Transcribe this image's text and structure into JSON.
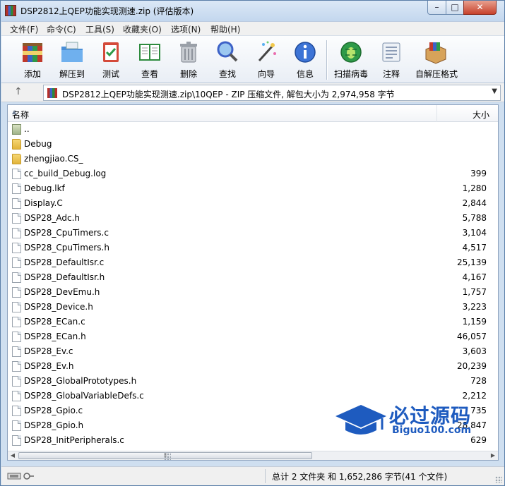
{
  "window": {
    "title": "DSP2812上QEP功能实现测速.zip (评估版本)",
    "controls": {
      "minimize": "–",
      "maximize": "□",
      "close": "✕"
    }
  },
  "menu": [
    "文件(F)",
    "命令(C)",
    "工具(S)",
    "收藏夹(O)",
    "选项(N)",
    "帮助(H)"
  ],
  "toolbar": [
    {
      "label": "添加",
      "icon": "add-archive-icon"
    },
    {
      "label": "解压到",
      "icon": "extract-folder-icon"
    },
    {
      "label": "测试",
      "icon": "test-clipboard-icon"
    },
    {
      "label": "查看",
      "icon": "view-book-icon"
    },
    {
      "label": "删除",
      "icon": "trash-can-icon"
    },
    {
      "label": "查找",
      "icon": "magnifier-icon"
    },
    {
      "label": "向导",
      "icon": "wizard-wand-icon"
    },
    {
      "label": "信息",
      "icon": "info-icon"
    },
    {
      "label": "扫描病毒",
      "icon": "virus-scan-icon"
    },
    {
      "label": "注释",
      "icon": "comment-icon"
    },
    {
      "label": "自解压格式",
      "icon": "sfx-box-icon"
    }
  ],
  "address": {
    "text": "DSP2812上QEP功能实现测速.zip\\10QEP - ZIP 压缩文件, 解包大小为 2,974,958 字节"
  },
  "columns": {
    "name": "名称",
    "size": "大小"
  },
  "files": [
    {
      "name": "..",
      "size": "",
      "type": "up"
    },
    {
      "name": "Debug",
      "size": "",
      "type": "folder"
    },
    {
      "name": "zhengjiao.CS_",
      "size": "",
      "type": "folder"
    },
    {
      "name": "cc_build_Debug.log",
      "size": "399",
      "type": "file"
    },
    {
      "name": "Debug.lkf",
      "size": "1,280",
      "type": "file"
    },
    {
      "name": "Display.C",
      "size": "2,844",
      "type": "file"
    },
    {
      "name": "DSP28_Adc.h",
      "size": "5,788",
      "type": "file"
    },
    {
      "name": "DSP28_CpuTimers.c",
      "size": "3,104",
      "type": "file"
    },
    {
      "name": "DSP28_CpuTimers.h",
      "size": "4,517",
      "type": "file"
    },
    {
      "name": "DSP28_DefaultIsr.c",
      "size": "25,139",
      "type": "file"
    },
    {
      "name": "DSP28_DefaultIsr.h",
      "size": "4,167",
      "type": "file"
    },
    {
      "name": "DSP28_DevEmu.h",
      "size": "1,757",
      "type": "file"
    },
    {
      "name": "DSP28_Device.h",
      "size": "3,223",
      "type": "file"
    },
    {
      "name": "DSP28_ECan.c",
      "size": "1,159",
      "type": "file"
    },
    {
      "name": "DSP28_ECan.h",
      "size": "46,057",
      "type": "file"
    },
    {
      "name": "DSP28_Ev.c",
      "size": "3,603",
      "type": "file"
    },
    {
      "name": "DSP28_Ev.h",
      "size": "20,239",
      "type": "file"
    },
    {
      "name": "DSP28_GlobalPrototypes.h",
      "size": "728",
      "type": "file"
    },
    {
      "name": "DSP28_GlobalVariableDefs.c",
      "size": "2,212",
      "type": "file"
    },
    {
      "name": "DSP28_Gpio.c",
      "size": "735",
      "type": "file"
    },
    {
      "name": "DSP28_Gpio.h",
      "size": "28,847",
      "type": "file"
    },
    {
      "name": "DSP28_InitPeripherals.c",
      "size": "629",
      "type": "file"
    }
  ],
  "watermark": {
    "text": "必过源码",
    "sub": "Biguo100.com"
  },
  "status": {
    "text": "总计 2 文件夹 和 1,652,286 字节(41 个文件)"
  }
}
